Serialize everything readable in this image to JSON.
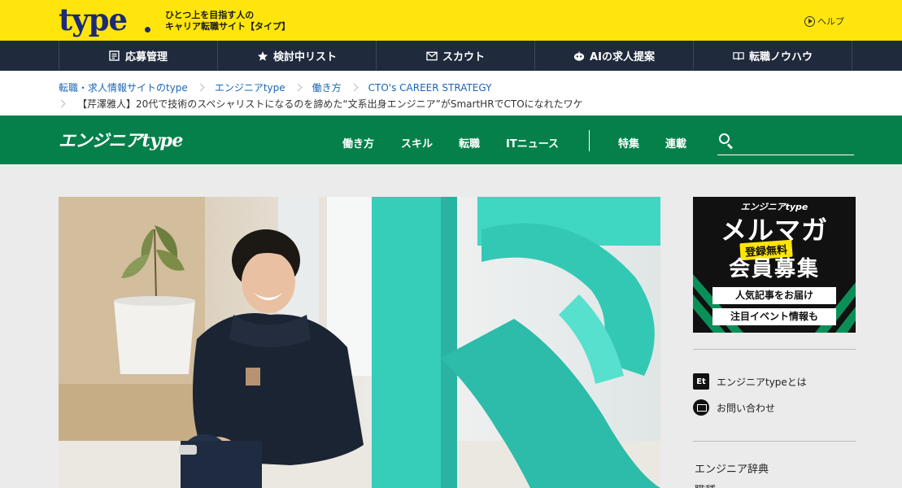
{
  "topbar": {
    "logo": "type",
    "tagline_line1": "ひとつ上を目指す人の",
    "tagline_line2": "キャリア転職サイト【タイプ】",
    "help_label": "ヘルプ"
  },
  "main_nav": [
    {
      "label": "応募管理",
      "icon": "application-management-icon"
    },
    {
      "label": "検討中リスト",
      "icon": "star-icon"
    },
    {
      "label": "スカウト",
      "icon": "envelope-icon"
    },
    {
      "label": "AIの求人提案",
      "icon": "ai-robot-icon"
    },
    {
      "label": "転職ノウハウ",
      "icon": "book-icon"
    }
  ],
  "breadcrumb": {
    "items": [
      "転職・求人情報サイトのtype",
      "エンジニアtype",
      "働き方",
      "CTO's CAREER STRATEGY"
    ],
    "current": "【芹澤雅人】20代で技術のスペシャリストになるのを諦めた“文系出身エンジニア”がSmartHRでCTOになれたワケ"
  },
  "site_header": {
    "logo_text": "エンジニア",
    "logo_type": "type",
    "categories": [
      "働き方",
      "スキル",
      "転職",
      "ITニュース"
    ],
    "extras": [
      "特集",
      "連載"
    ],
    "search_placeholder": ""
  },
  "sidebar": {
    "banner": {
      "logo": "エンジニアtype",
      "title": "メルマガ",
      "badge": "登録無料",
      "subtitle": "会員募集",
      "line1": "人気記事をお届け",
      "line2": "注目イベント情報も"
    },
    "links": [
      {
        "label": "エンジニアtypeとは",
        "icon": "et-icon"
      },
      {
        "label": "お問い合わせ",
        "icon": "mail-icon"
      }
    ],
    "section_title": "エンジニア辞典",
    "section_item": "職種"
  },
  "colors": {
    "yellow": "#ffe50b",
    "navy": "#1f2a3c",
    "green": "#05804a",
    "link_blue": "#1a66b8",
    "teal_sign": "#2fd0bd"
  }
}
